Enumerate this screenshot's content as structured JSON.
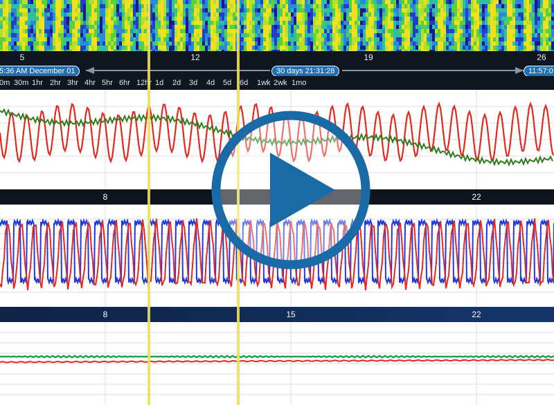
{
  "timeline": {
    "ticks": [
      "5",
      "12",
      "19",
      "26"
    ]
  },
  "range": {
    "start_label": "5:36 AM  December 01",
    "span_label": "30 days 21:31:28",
    "end_label": "11:57:0"
  },
  "zoom_options": [
    "0m",
    "30m",
    "1hr",
    "2hr",
    "3hr",
    "4hr",
    "5hr",
    "6hr",
    "12hr",
    "1d",
    "2d",
    "3d",
    "4d",
    "5d",
    "6d",
    "1wk",
    "2wk",
    "1mo"
  ],
  "panel_axes": [
    {
      "ticks": [
        "8",
        "15",
        "22"
      ]
    },
    {
      "ticks": [
        "8",
        "15",
        "22"
      ]
    }
  ],
  "colors": {
    "red_series": "#e8261c",
    "green_series": "#2e7a1c",
    "blue_series": "#1d38e8",
    "cursor": "#f0e05a",
    "play_button": "#1b6aa8"
  },
  "icons": {
    "play": "play-icon",
    "range_arrow": "double-arrow-icon"
  }
}
